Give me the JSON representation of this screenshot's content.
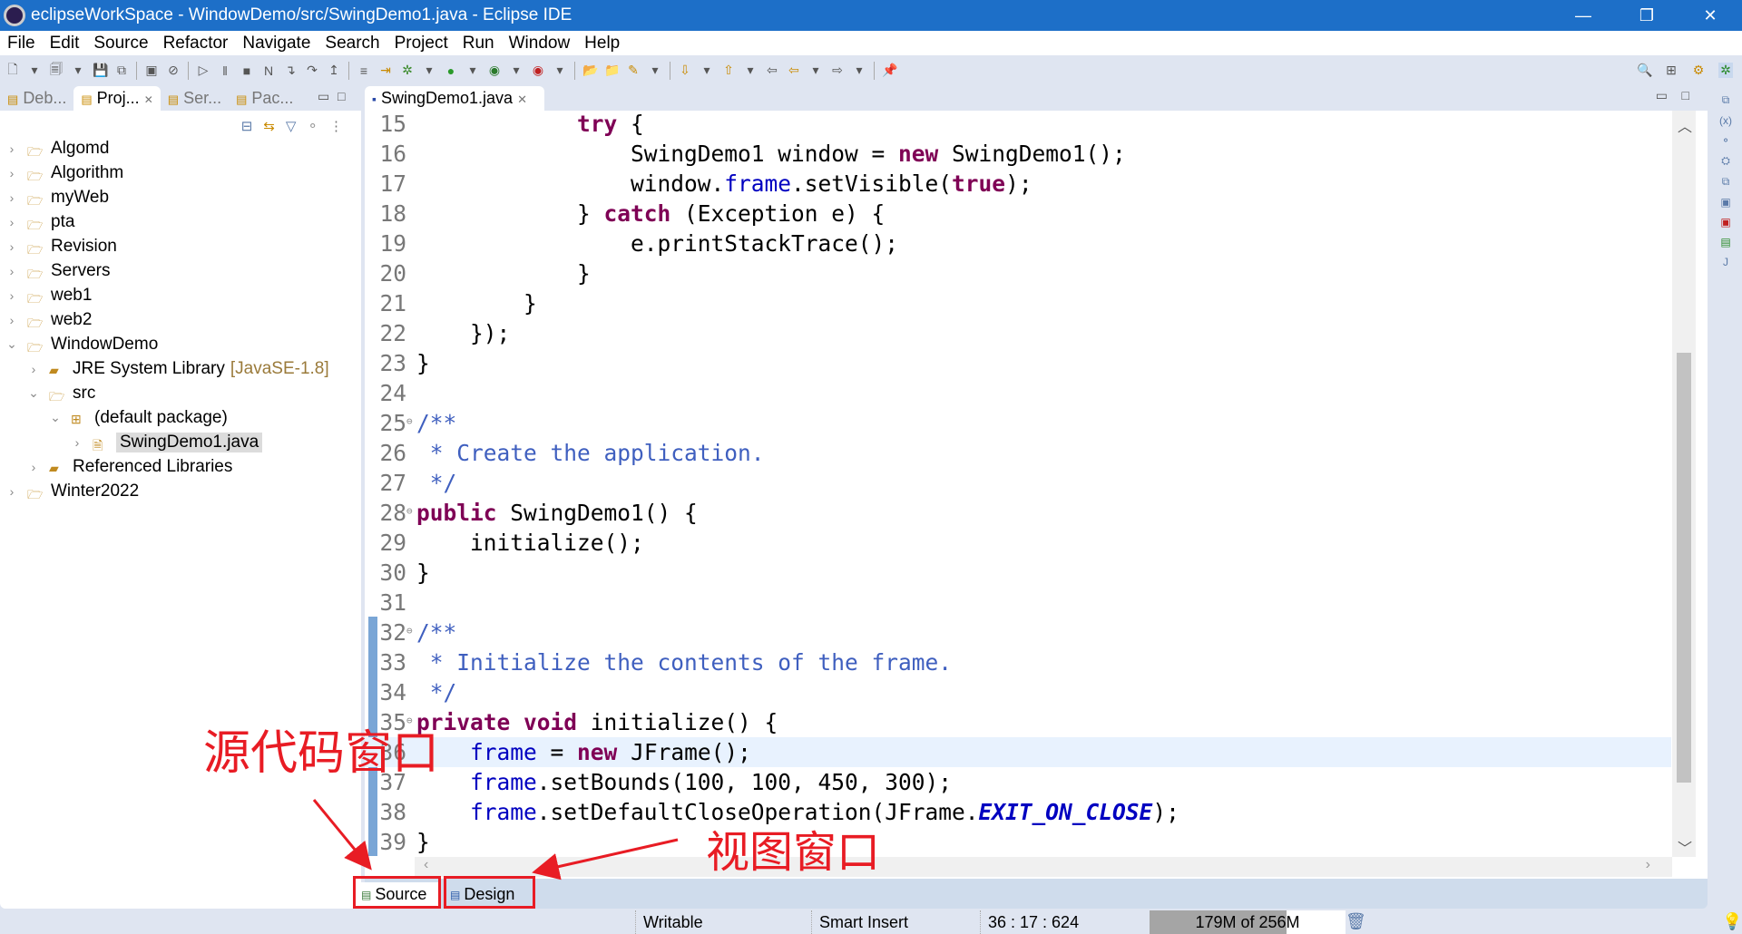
{
  "window": {
    "title": "eclipseWorkSpace - WindowDemo/src/SwingDemo1.java - Eclipse IDE",
    "controls": [
      "—",
      "❐",
      "✕"
    ]
  },
  "menu": [
    "File",
    "Edit",
    "Source",
    "Refactor",
    "Navigate",
    "Search",
    "Project",
    "Run",
    "Window",
    "Help"
  ],
  "left_tabs": [
    {
      "label": "Deb...",
      "icon": "debug-icon"
    },
    {
      "label": "Proj...",
      "icon": "project-explorer-icon",
      "active": true
    },
    {
      "label": "Ser...",
      "icon": "servers-icon"
    },
    {
      "label": "Pac...",
      "icon": "package-explorer-icon"
    }
  ],
  "tree": [
    {
      "label": "Algomd",
      "depth": 0,
      "expanded": false
    },
    {
      "label": "Algorithm",
      "depth": 0,
      "expanded": false
    },
    {
      "label": "myWeb",
      "depth": 0,
      "expanded": false
    },
    {
      "label": "pta",
      "depth": 0,
      "expanded": false
    },
    {
      "label": "Revision",
      "depth": 0,
      "expanded": false
    },
    {
      "label": "Servers",
      "depth": 0,
      "expanded": false
    },
    {
      "label": "web1",
      "depth": 0,
      "expanded": false
    },
    {
      "label": "web2",
      "depth": 0,
      "expanded": false
    },
    {
      "label": "WindowDemo",
      "depth": 0,
      "expanded": true
    },
    {
      "label": "JRE System Library",
      "extra": "[JavaSE-1.8]",
      "depth": 1,
      "expanded": false
    },
    {
      "label": "src",
      "depth": 1,
      "expanded": true
    },
    {
      "label": "(default package)",
      "depth": 2,
      "expanded": true
    },
    {
      "label": "SwingDemo1.java",
      "depth": 3,
      "expanded": false,
      "selected": true
    },
    {
      "label": "Referenced Libraries",
      "depth": 1,
      "expanded": false
    },
    {
      "label": "Winter2022",
      "depth": 0,
      "expanded": false
    }
  ],
  "editor": {
    "tab": "SwingDemo1.java",
    "current_line": 36,
    "lines": [
      {
        "n": 15,
        "t": [
          [
            "p",
            "            "
          ],
          [
            "kw",
            "try"
          ],
          [
            "p",
            " {"
          ]
        ]
      },
      {
        "n": 16,
        "t": [
          [
            "p",
            "                SwingDemo1 window = "
          ],
          [
            "kw",
            "new"
          ],
          [
            "p",
            " SwingDemo1();"
          ]
        ]
      },
      {
        "n": 17,
        "t": [
          [
            "p",
            "                window."
          ],
          [
            "fld",
            "frame"
          ],
          [
            "p",
            ".setVisible("
          ],
          [
            "kw",
            "true"
          ],
          [
            "p",
            ");"
          ]
        ]
      },
      {
        "n": 18,
        "t": [
          [
            "p",
            "            } "
          ],
          [
            "kw",
            "catch"
          ],
          [
            "p",
            " (Exception e) {"
          ]
        ]
      },
      {
        "n": 19,
        "t": [
          [
            "p",
            "                e.printStackTrace();"
          ]
        ]
      },
      {
        "n": 20,
        "t": [
          [
            "p",
            "            }"
          ]
        ]
      },
      {
        "n": 21,
        "t": [
          [
            "p",
            "        }"
          ]
        ]
      },
      {
        "n": 22,
        "t": [
          [
            "p",
            "    });"
          ]
        ]
      },
      {
        "n": 23,
        "t": [
          [
            "p",
            "}"
          ]
        ]
      },
      {
        "n": 24,
        "t": []
      },
      {
        "n": 25,
        "fold": true,
        "t": [
          [
            "cm",
            "/**"
          ]
        ]
      },
      {
        "n": 26,
        "t": [
          [
            "cm",
            " * Create the application."
          ]
        ]
      },
      {
        "n": 27,
        "t": [
          [
            "cm",
            " */"
          ]
        ]
      },
      {
        "n": 28,
        "fold": true,
        "t": [
          [
            "kw",
            "public"
          ],
          [
            "p",
            " SwingDemo1() {"
          ]
        ]
      },
      {
        "n": 29,
        "t": [
          [
            "p",
            "    initialize();"
          ]
        ]
      },
      {
        "n": 30,
        "t": [
          [
            "p",
            "}"
          ]
        ]
      },
      {
        "n": 31,
        "t": []
      },
      {
        "n": 32,
        "fold": true,
        "t": [
          [
            "cm",
            "/**"
          ]
        ]
      },
      {
        "n": 33,
        "t": [
          [
            "cm",
            " * Initialize the contents of the frame."
          ]
        ]
      },
      {
        "n": 34,
        "t": [
          [
            "cm",
            " */"
          ]
        ]
      },
      {
        "n": 35,
        "fold": true,
        "t": [
          [
            "kw",
            "private"
          ],
          [
            "p",
            " "
          ],
          [
            "kw",
            "void"
          ],
          [
            "p",
            " initialize() {"
          ]
        ]
      },
      {
        "n": 36,
        "t": [
          [
            "p",
            "    "
          ],
          [
            "fld",
            "frame"
          ],
          [
            "p",
            " = "
          ],
          [
            "kw",
            "new"
          ],
          [
            "p",
            " JFrame();"
          ]
        ]
      },
      {
        "n": 37,
        "t": [
          [
            "p",
            "    "
          ],
          [
            "fld",
            "frame"
          ],
          [
            "p",
            ".setBounds(100, 100, 450, 300);"
          ]
        ]
      },
      {
        "n": 38,
        "t": [
          [
            "p",
            "    "
          ],
          [
            "fld",
            "frame"
          ],
          [
            "p",
            ".setDefaultCloseOperation(JFrame."
          ],
          [
            "st",
            "EXIT_ON_CLOSE"
          ],
          [
            "p",
            ");"
          ]
        ]
      },
      {
        "n": 39,
        "t": [
          [
            "p",
            "}"
          ]
        ]
      }
    ]
  },
  "bottom_tabs": {
    "source": "Source",
    "design": "Design"
  },
  "status": {
    "writable": "Writable",
    "insert_mode": "Smart Insert",
    "position": "36 : 17 : 624",
    "memory": "179M of 256M",
    "memory_used_fraction": 0.7
  },
  "annotations": {
    "source_window": "源代码窗口",
    "design_window": "视图窗口",
    "color": "#e81c24"
  }
}
